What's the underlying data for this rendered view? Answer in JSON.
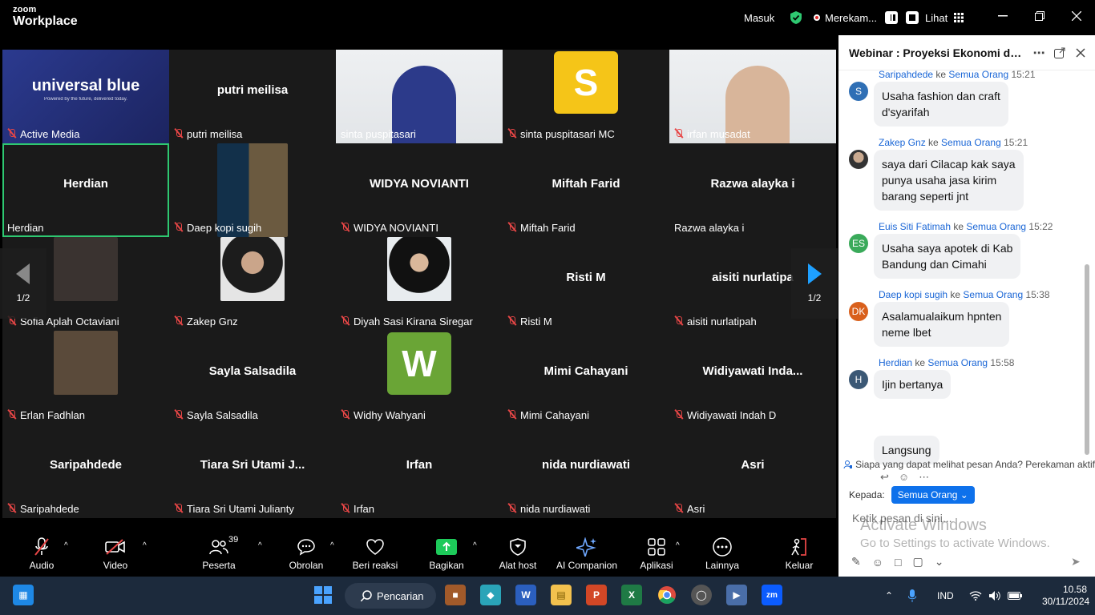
{
  "titlebar": {
    "logo_small": "zoom",
    "logo_big": "Workplace",
    "masuk": "Masuk",
    "recording": "Merekam...",
    "lihat": "Lihat"
  },
  "tiles": [
    {
      "name": "Active Media",
      "center": "",
      "type": "banner",
      "muted": true
    },
    {
      "name": "putri meilisa",
      "center": "putri meilisa",
      "type": "name",
      "muted": true
    },
    {
      "name": "sinta puspitasari",
      "center": "",
      "type": "video",
      "muted": false
    },
    {
      "name": "sinta puspitasari MC",
      "center": "",
      "type": "avatar",
      "letter": "S",
      "color": "#f5c518",
      "muted": true
    },
    {
      "name": "irfan musadat",
      "center": "",
      "type": "video",
      "muted": true
    },
    {
      "name": "Herdian",
      "center": "Herdian",
      "type": "name",
      "muted": false,
      "active": true
    },
    {
      "name": "Daep kopi sugih",
      "center": "",
      "type": "photo",
      "muted": true
    },
    {
      "name": "WIDYA NOVIANTI",
      "center": "WIDYA NOVIANTI",
      "type": "name",
      "muted": true
    },
    {
      "name": "Miftah Farid",
      "center": "Miftah Farid",
      "type": "name",
      "muted": true
    },
    {
      "name": "Razwa alayka i",
      "center": "Razwa alayka i",
      "type": "name",
      "muted": false
    },
    {
      "name": "Sofia Aplah Octaviani",
      "center": "",
      "type": "photo",
      "muted": true
    },
    {
      "name": "Zakep Gnz",
      "center": "",
      "type": "photo",
      "muted": true
    },
    {
      "name": "Diyah Sasi Kirana Siregar",
      "center": "",
      "type": "photo",
      "muted": true
    },
    {
      "name": "Risti M",
      "center": "Risti M",
      "type": "name",
      "muted": true
    },
    {
      "name": "aisiti nurlatipah",
      "center": "aisiti nurlatipa",
      "type": "name",
      "muted": true
    },
    {
      "name": "Erlan Fadhlan",
      "center": "",
      "type": "photo",
      "muted": true
    },
    {
      "name": "Sayla Salsadila",
      "center": "Sayla Salsadila",
      "type": "name",
      "muted": true
    },
    {
      "name": "Widhy Wahyani",
      "center": "",
      "type": "avatar",
      "letter": "W",
      "color": "#6aa536",
      "muted": true
    },
    {
      "name": "Mimi Cahayani",
      "center": "Mimi Cahayani",
      "type": "name",
      "muted": true
    },
    {
      "name": "Widiyawati Indah D",
      "center": "Widiyawati  Inda...",
      "type": "name",
      "muted": true
    },
    {
      "name": "Saripahdede",
      "center": "Saripahdede",
      "type": "name",
      "muted": true
    },
    {
      "name": "Tiara Sri Utami Julianty",
      "center": "Tiara Sri Utami J...",
      "type": "name",
      "muted": true
    },
    {
      "name": "Irfan",
      "center": "Irfan",
      "type": "name",
      "muted": true
    },
    {
      "name": "nida nurdiawati",
      "center": "nida nurdiawati",
      "type": "name",
      "muted": true
    },
    {
      "name": "Asri",
      "center": "Asri",
      "type": "name",
      "muted": true
    }
  ],
  "banner": {
    "title": "universal blue",
    "subtitle": "Powered by the future, delivered today."
  },
  "pager": {
    "prev": "1/2",
    "next": "1/2"
  },
  "toolbar": {
    "audio": "Audio",
    "video": "Video",
    "peserta": "Peserta",
    "peserta_count": "39",
    "obrolan": "Obrolan",
    "reaksi": "Beri reaksi",
    "bagikan": "Bagikan",
    "alat_host": "Alat host",
    "ai": "AI Companion",
    "aplikasi": "Aplikasi",
    "lainnya": "Lainnya",
    "keluar": "Keluar"
  },
  "chat": {
    "title": "Webinar : Proyeksi Ekonomi  dan...",
    "ke": "ke",
    "messages": [
      {
        "sender": "Saripahdede",
        "to": "Semua Orang",
        "time": "15:21",
        "avatar": "S",
        "avatar_color": "#2f6fb5",
        "lines": [
          "Usaha fashion dan craft",
          "d'syarifah"
        ]
      },
      {
        "sender": "Zakep Gnz",
        "to": "Semua Orang",
        "time": "15:21",
        "avatar": "",
        "avatar_color": "#8a7a6a",
        "lines": [
          "saya dari Cilacap kak saya",
          "punya usaha jasa kirim",
          "barang seperti jnt"
        ]
      },
      {
        "sender": "Euis Siti Fatimah",
        "to": "Semua Orang",
        "time": "15:22",
        "avatar": "ES",
        "avatar_color": "#3aaa5a",
        "lines": [
          "Usaha saya apotek di Kab",
          "Bandung dan Cimahi"
        ]
      },
      {
        "sender": "Daep kopi sugih",
        "to": "Semua Orang",
        "time": "15:38",
        "avatar": "DK",
        "avatar_color": "#d9601c",
        "lines": [
          "Asalamualaikum hpnten",
          "neme lbet"
        ]
      },
      {
        "sender": "Herdian",
        "to": "Semua Orang",
        "time": "15:58",
        "avatar": "H",
        "avatar_color": "#3b5875",
        "lines": [
          "Ijin bertanya"
        ]
      }
    ],
    "extra_bubble": "Langsung",
    "privacy": "Siapa yang dapat melihat pesan Anda? Perekaman aktif",
    "kepada": "Kepada:",
    "recipient": "Semua Orang",
    "placeholder": "Ketik pesan di sini...",
    "watermark_title": "Activate Windows",
    "watermark_sub": "Go to Settings to activate Windows."
  },
  "taskbar": {
    "search": "Pencarian",
    "lang": "IND",
    "time": "10.58",
    "date": "30/11/2024"
  }
}
